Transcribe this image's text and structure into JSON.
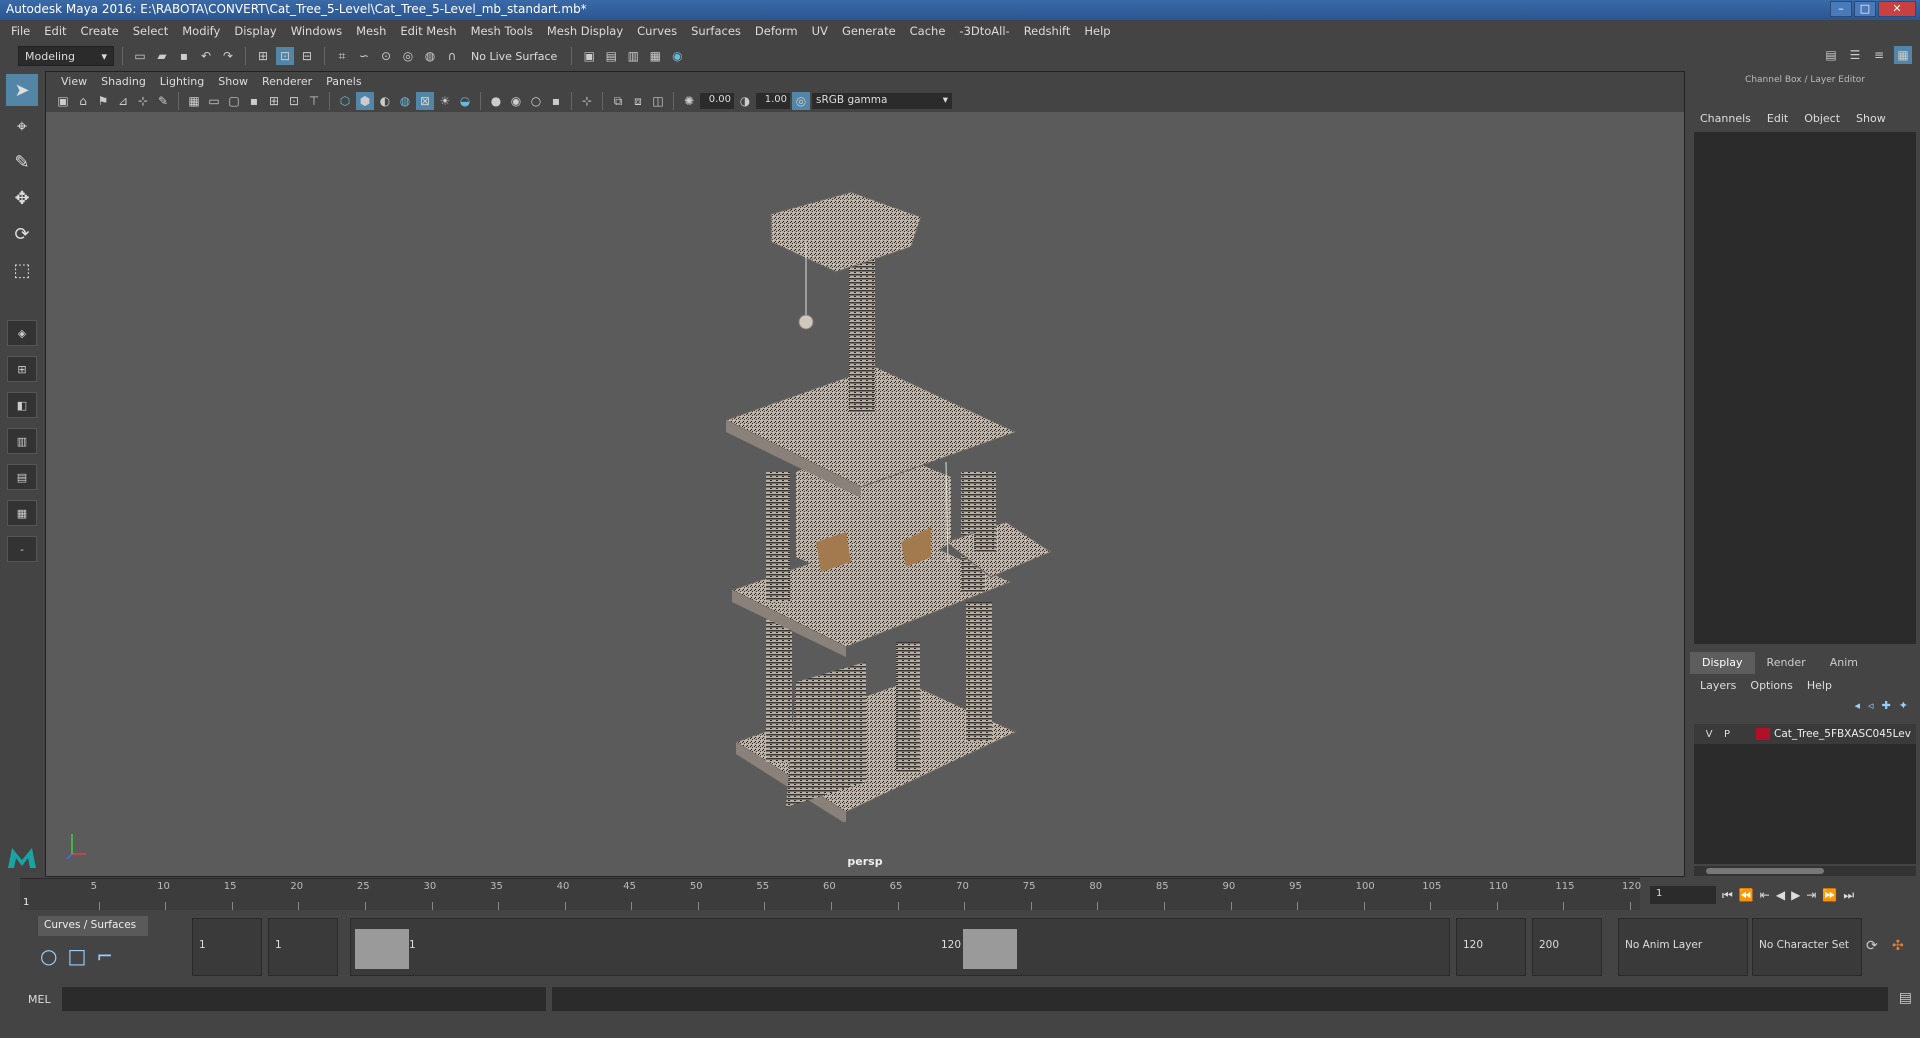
{
  "window": {
    "title": "Autodesk Maya 2016: E:\\RABOTA\\CONVERT\\Cat_Tree_5-Level\\Cat_Tree_5-Level_mb_standart.mb*"
  },
  "menubar": [
    "File",
    "Edit",
    "Create",
    "Select",
    "Modify",
    "Display",
    "Windows",
    "Mesh",
    "Edit Mesh",
    "Mesh Tools",
    "Mesh Display",
    "Curves",
    "Surfaces",
    "Deform",
    "UV",
    "Generate",
    "Cache",
    "-3DtoAll-",
    "Redshift",
    "Help"
  ],
  "shelf": {
    "mode": "Modeling",
    "live_surface": "No Live Surface"
  },
  "viewport": {
    "menu": [
      "View",
      "Shading",
      "Lighting",
      "Show",
      "Renderer",
      "Panels"
    ],
    "exposure": "0.00",
    "gamma": "1.00",
    "color_space": "sRGB gamma",
    "camera": "persp"
  },
  "channelbox": {
    "title": "Channel Box / Layer Editor",
    "menu": [
      "Channels",
      "Edit",
      "Object",
      "Show"
    ]
  },
  "layers": {
    "tabs": [
      "Display",
      "Render",
      "Anim"
    ],
    "menu": [
      "Layers",
      "Options",
      "Help"
    ],
    "items": [
      {
        "v": "V",
        "p": "P",
        "name": "Cat_Tree_5FBXASC045Lev",
        "color": "#b0102a"
      }
    ]
  },
  "timeline": {
    "ticks": [
      "5",
      "10",
      "15",
      "20",
      "25",
      "30",
      "35",
      "40",
      "45",
      "50",
      "55",
      "60",
      "65",
      "70",
      "75",
      "80",
      "85",
      "90",
      "95",
      "100",
      "105",
      "110",
      "115",
      "120"
    ],
    "start_mark": "1",
    "current_frame": "1"
  },
  "range": {
    "shelf_tab": "Curves / Surfaces",
    "start": "1",
    "playback_start": "1",
    "range_start": "1",
    "range_end": "120",
    "playback_end": "120",
    "end": "200",
    "anim_layer": "No Anim Layer",
    "character_set": "No Character Set"
  },
  "mel": {
    "label": "MEL"
  }
}
